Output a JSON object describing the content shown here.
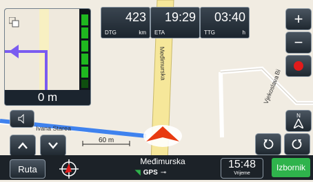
{
  "stats": {
    "dtg": {
      "label": "DTG",
      "value": "423",
      "unit": "km"
    },
    "eta": {
      "label": "ETA",
      "value": "19:29"
    },
    "ttg": {
      "label": "TTG",
      "value": "03:40",
      "unit": "h"
    }
  },
  "maneuver": {
    "distance": "0 m"
  },
  "map": {
    "street_main": "Međimurska",
    "street_right": "Vjekoslava",
    "street_right_short": "Bi",
    "street_left": "Ivana Starea",
    "scale_label": "60 m"
  },
  "bottom_bar": {
    "route_button": "Ruta",
    "current_street": "Međimurska",
    "gps_label": "GPS",
    "time": "15:48",
    "time_label": "Vrijeme",
    "menu_button": "Izbornik"
  },
  "buttons": {
    "zoom_in": "+",
    "zoom_out": "−",
    "north": "N"
  },
  "colors": {
    "route": "#3f82ee",
    "maneuver_arrow": "#a259f0",
    "accent_green": "#2fb34c",
    "record_red": "#e11b1b"
  }
}
